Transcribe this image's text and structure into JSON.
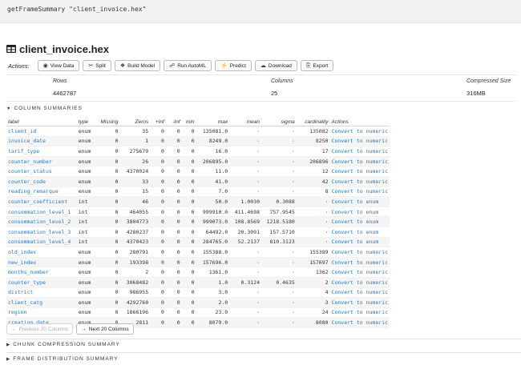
{
  "command": "getFrameSummary \"client_invoice.hex\"",
  "frame": {
    "title": "client_invoice.hex",
    "actions_label": "Actions:",
    "actions": [
      {
        "id": "view-data",
        "label": "View Data",
        "icon": "eye-icon",
        "glyph": "◉"
      },
      {
        "id": "split",
        "label": "Split",
        "icon": "scissors-icon",
        "glyph": "✂"
      },
      {
        "id": "build-model",
        "label": "Build Model",
        "icon": "cube-icon",
        "glyph": "❖"
      },
      {
        "id": "run-automl",
        "label": "Run AutoML",
        "icon": "sitemap-icon",
        "glyph": "☍"
      },
      {
        "id": "predict",
        "label": "Predict",
        "icon": "bolt-icon",
        "glyph": "⚡"
      },
      {
        "id": "download",
        "label": "Download",
        "icon": "cloud-download-icon",
        "glyph": "☁"
      },
      {
        "id": "export",
        "label": "Export",
        "icon": "save-icon",
        "glyph": "⎘"
      }
    ],
    "summary": {
      "rows_label": "Rows",
      "rows_value": "4462787",
      "columns_label": "Columns",
      "columns_value": "25",
      "size_label": "Compressed Size",
      "size_value": "316MB"
    }
  },
  "sections": {
    "column_summaries": "COLUMN SUMMARIES",
    "chunk_compression": "CHUNK COMPRESSION SUMMARY",
    "frame_distribution": "FRAME DISTRIBUTION SUMMARY"
  },
  "table": {
    "headers": [
      "label",
      "type",
      "Missing",
      "Zeros",
      "+Inf",
      "-Inf",
      "min",
      "max",
      "mean",
      "sigma",
      "cardinality",
      "Actions"
    ],
    "rows": [
      [
        "client_id",
        "enum",
        "0",
        "35",
        "0",
        "0",
        "0",
        "135081.0",
        "·",
        "·",
        "135082",
        "Convert to numeric"
      ],
      [
        "invoice_date",
        "enum",
        "0",
        "1",
        "0",
        "0",
        "0",
        "8249.0",
        "·",
        "·",
        "8250",
        "Convert to numeric"
      ],
      [
        "tarif_type",
        "enum",
        "0",
        "275679",
        "0",
        "0",
        "0",
        "16.0",
        "·",
        "·",
        "17",
        "Convert to numeric"
      ],
      [
        "counter_number",
        "enum",
        "0",
        "26",
        "0",
        "0",
        "0",
        "206895.0",
        "·",
        "·",
        "206896",
        "Convert to numeric"
      ],
      [
        "counter_status",
        "enum",
        "0",
        "4370024",
        "0",
        "0",
        "0",
        "11.0",
        "·",
        "·",
        "12",
        "Convert to numeric"
      ],
      [
        "counter_code",
        "enum",
        "0",
        "33",
        "0",
        "0",
        "0",
        "41.0",
        "·",
        "·",
        "42",
        "Convert to numeric"
      ],
      [
        "reading_remarque",
        "enum",
        "0",
        "15",
        "0",
        "0",
        "0",
        "7.0",
        "·",
        "·",
        "8",
        "Convert to numeric"
      ],
      [
        "counter_coefficient",
        "int",
        "0",
        "46",
        "0",
        "0",
        "0",
        "50.0",
        "1.0030",
        "0.3088",
        "·",
        "Convert to enum"
      ],
      [
        "consommation_level_1",
        "int",
        "0",
        "464055",
        "0",
        "0",
        "0",
        "999910.0",
        "411.4698",
        "757.9545",
        "·",
        "Convert to enum"
      ],
      [
        "consommation_level_2",
        "int",
        "0",
        "3804773",
        "0",
        "0",
        "0",
        "999073.0",
        "108.8569",
        "1218.5180",
        "·",
        "Convert to enum"
      ],
      [
        "consommation_level_3",
        "int",
        "0",
        "4280237",
        "0",
        "0",
        "0",
        "64492.0",
        "20.3091",
        "157.5710",
        "·",
        "Convert to enum"
      ],
      [
        "consommation_level_4",
        "int",
        "0",
        "4370423",
        "0",
        "0",
        "0",
        "284765.0",
        "52.2137",
        "810.3123",
        "·",
        "Convert to enum"
      ],
      [
        "old_index",
        "enum",
        "0",
        "280791",
        "0",
        "0",
        "0",
        "155388.0",
        "·",
        "·",
        "155389",
        "Convert to numeric"
      ],
      [
        "new_index",
        "enum",
        "0",
        "193398",
        "0",
        "0",
        "0",
        "157696.0",
        "·",
        "·",
        "157697",
        "Convert to numeric"
      ],
      [
        "months_number",
        "enum",
        "0",
        "2",
        "0",
        "0",
        "0",
        "1361.0",
        "·",
        "·",
        "1362",
        "Convert to numeric"
      ],
      [
        "counter_type",
        "enum",
        "0",
        "3068482",
        "0",
        "0",
        "0",
        "1.0",
        "0.3124",
        "0.4635",
        "2",
        "Convert to numeric"
      ],
      [
        "district",
        "enum",
        "0",
        "986955",
        "0",
        "0",
        "0",
        "3.0",
        "·",
        "·",
        "4",
        "Convert to numeric"
      ],
      [
        "client_catg",
        "enum",
        "0",
        "4292760",
        "0",
        "0",
        "0",
        "2.0",
        "·",
        "·",
        "3",
        "Convert to numeric"
      ],
      [
        "region",
        "enum",
        "0",
        "1866196",
        "0",
        "0",
        "0",
        "23.0",
        "·",
        "·",
        "24",
        "Convert to numeric"
      ],
      [
        "creation_date",
        "enum",
        "0",
        "2811",
        "0",
        "0",
        "0",
        "8079.0",
        "·",
        "·",
        "8080",
        "Convert to numeric"
      ]
    ]
  },
  "pager": {
    "prev_label": "Previous 20 Columns",
    "next_label": "Next 20 Columns"
  }
}
